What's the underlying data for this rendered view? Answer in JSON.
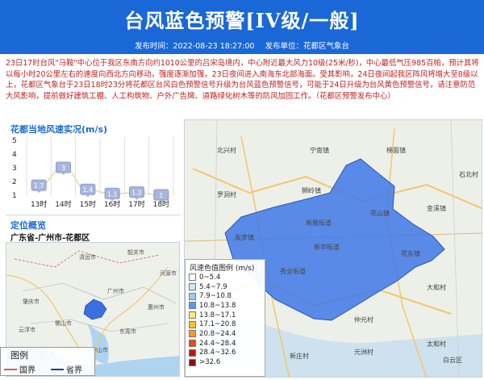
{
  "header": {
    "title": "台风蓝色预警[IV级/一般]",
    "publish_time_label": "发布时间：2022-08-23 18:27:00",
    "publisher_label": "发布单位：花都区气象台",
    "bg_color": "#1a68d8"
  },
  "description": "23日17时台风\"马鞍\"中心位于我区东南方向约1010公里的吕宋岛境内，中心附近最大风力10级(25米/秒)，中心最低气压985百帕，预计其将以每小时20公里左右的速度向西北方向移动，强度逐渐加强，23日夜间进入南海东北部海面。受其影响，24日夜间起我区阵风将增大至8级以上，花都区气象台于23日18时23分将花都区台风白色预警信号升级为台风蓝色预警信号，可能于24日升级为台风黄色预警信号，请注意防范大风影响，提前做好建筑工棚、人工构筑物、户外广告牌、道路绿化树木等的防风加固工作。（花都区预警发布中心）",
  "wind": {
    "title": "花都当地风速实况(m/s)",
    "chart_data": {
      "type": "line",
      "title": "花都当地风速实况(m/s)",
      "x": [
        "13时",
        "14时",
        "15时",
        "16时",
        "17时",
        "18时"
      ],
      "y": [
        1.7,
        3,
        1.4,
        1.1,
        1.2,
        1
      ],
      "labels": [
        "1.7",
        "3",
        "1.4",
        "1.1",
        "1.2",
        "1"
      ],
      "ylim": [
        1,
        5
      ],
      "yticks": [
        "1",
        "2",
        "3",
        "4",
        "5"
      ],
      "grid": true
    }
  },
  "location": {
    "title": "定位概览",
    "region": "广东省-广州市-花都区"
  },
  "legend_small": {
    "title": "图例",
    "items": [
      {
        "label": "国界",
        "color": "#d06060"
      },
      {
        "label": "省界",
        "color": "#1a3fb0"
      }
    ]
  },
  "legend_big": {
    "title": "风速色值图例 (m/s)",
    "items": [
      {
        "label": "0~5.4",
        "color": "#ffffff"
      },
      {
        "label": "5.4~7.9",
        "color": "#cde6fb"
      },
      {
        "label": "7.9~10.8",
        "color": "#9fcbf2"
      },
      {
        "label": "10.8~13.8",
        "color": "#5b9ae6"
      },
      {
        "label": "13.8~17.1",
        "color": "#ffe97a"
      },
      {
        "label": "17.1~20.8",
        "color": "#f7c32b"
      },
      {
        "label": "20.8~24.4",
        "color": "#f59b21"
      },
      {
        "label": "24.4~28.4",
        "color": "#e94a1c"
      },
      {
        "label": "28.4~32.6",
        "color": "#c41515"
      },
      {
        "label": ">32.6",
        "color": "#8b1010"
      }
    ]
  },
  "map_labels": {
    "big": [
      "宁南镇",
      "炭步镇",
      "金溪镇",
      "新华街道",
      "花山镇",
      "花东镇",
      "新雅街道",
      "秀全街道",
      "狮岭镇",
      "梯面镇",
      "罗洞村",
      "北兴村",
      "仲元村",
      "大和村",
      "元洲村",
      "太和村",
      "东风村",
      "石北村",
      "新庄村",
      "白云区"
    ],
    "mini": [
      "清远市",
      "韶关市",
      "肇庆市",
      "广州市",
      "佛山市",
      "东莞市",
      "惠州市",
      "中山市",
      "江门市",
      "阳江市",
      "云浮市",
      "河源市"
    ]
  }
}
